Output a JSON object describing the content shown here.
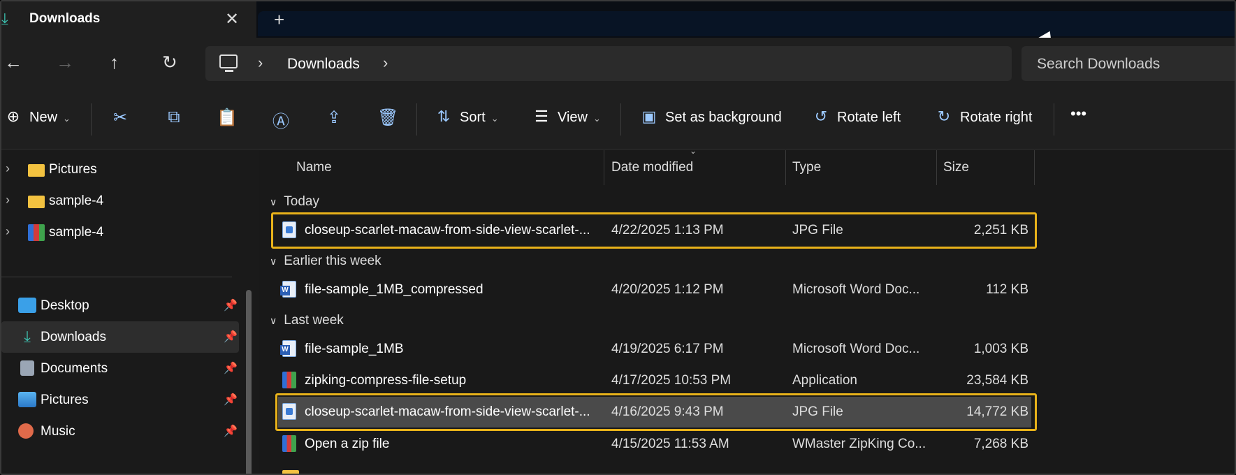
{
  "tab": {
    "title": "Downloads",
    "close": "✕",
    "new_tab": "+"
  },
  "nav": {
    "back": "←",
    "forward": "→",
    "up": "↑",
    "refresh": "↻",
    "sep": "›"
  },
  "address": {
    "segment": "Downloads"
  },
  "search": {
    "placeholder": "Search Downloads"
  },
  "toolbar": {
    "new_label": "New",
    "sort_label": "Sort",
    "view_label": "View",
    "set_bg_label": "Set as background",
    "rotate_left_label": "Rotate left",
    "rotate_right_label": "Rotate right",
    "more": "•••"
  },
  "sidebar": {
    "tree": [
      {
        "label": "Pictures",
        "icon": "folder-icon"
      },
      {
        "label": "sample-4",
        "icon": "folder-icon"
      },
      {
        "label": "sample-4",
        "icon": "archive-icon"
      }
    ],
    "quick_access": [
      {
        "label": "Desktop",
        "icon": "desktop-icon"
      },
      {
        "label": "Downloads",
        "icon": "download-icon"
      },
      {
        "label": "Documents",
        "icon": "documents-icon"
      },
      {
        "label": "Pictures",
        "icon": "pictures-icon"
      },
      {
        "label": "Music",
        "icon": "music-icon"
      }
    ]
  },
  "columns": {
    "name": "Name",
    "date": "Date modified",
    "type": "Type",
    "size": "Size"
  },
  "groups": {
    "today": "Today",
    "earlier": "Earlier this week",
    "last_week": "Last week"
  },
  "files": [
    {
      "name": "closeup-scarlet-macaw-from-side-view-scarlet-...",
      "date": "4/22/2025 1:13 PM",
      "type": "JPG File",
      "size": "2,251 KB",
      "icon": "jpg-icon"
    },
    {
      "name": "file-sample_1MB_compressed",
      "date": "4/20/2025 1:12 PM",
      "type": "Microsoft Word Doc...",
      "size": "112 KB",
      "icon": "word-icon"
    },
    {
      "name": "file-sample_1MB",
      "date": "4/19/2025 6:17 PM",
      "type": "Microsoft Word Doc...",
      "size": "1,003 KB",
      "icon": "word-icon"
    },
    {
      "name": "zipking-compress-file-setup",
      "date": "4/17/2025 10:53 PM",
      "type": "Application",
      "size": "23,584 KB",
      "icon": "app-icon"
    },
    {
      "name": "closeup-scarlet-macaw-from-side-view-scarlet-...",
      "date": "4/16/2025 9:43 PM",
      "type": "JPG File",
      "size": "14,772 KB",
      "icon": "jpg-icon"
    },
    {
      "name": "Open a zip file",
      "date": "4/15/2025 11:53 AM",
      "type": "WMaster ZipKing Co...",
      "size": "7,268 KB",
      "icon": "app-icon"
    }
  ]
}
